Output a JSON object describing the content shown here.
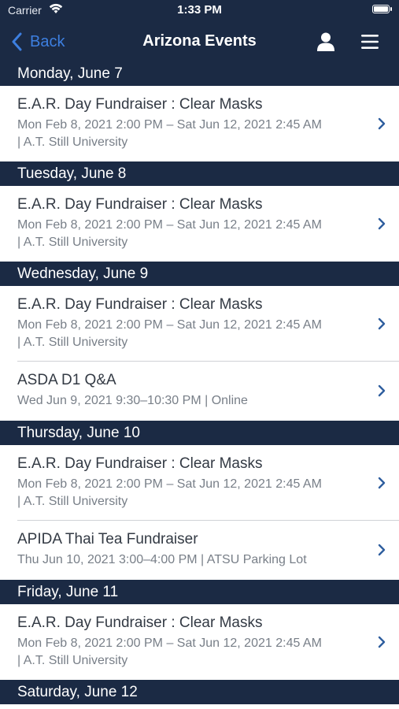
{
  "status_bar": {
    "carrier": "Carrier",
    "time": "1:33 PM"
  },
  "nav": {
    "back_label": "Back",
    "title": "Arizona Events"
  },
  "colors": {
    "header_bg": "#1b2a44",
    "accent": "#3d7fe0",
    "chevron": "#2e5e9e"
  },
  "icons": [
    "wifi-icon",
    "battery-icon",
    "back-chevron-icon",
    "user-icon",
    "menu-icon",
    "chevron-right-icon"
  ],
  "days": [
    {
      "label": "Monday, June 7",
      "events": [
        {
          "name": "E.A.R. Day Fundraiser : Clear Masks",
          "when": "Mon Feb 8, 2021 2:00 PM – Sat Jun 12, 2021 2:45 AM",
          "where": "| A.T. Still University"
        }
      ]
    },
    {
      "label": "Tuesday, June 8",
      "events": [
        {
          "name": "E.A.R. Day Fundraiser : Clear Masks",
          "when": "Mon Feb 8, 2021 2:00 PM – Sat Jun 12, 2021 2:45 AM",
          "where": "| A.T. Still University"
        }
      ]
    },
    {
      "label": "Wednesday, June 9",
      "events": [
        {
          "name": "E.A.R. Day Fundraiser : Clear Masks",
          "when": "Mon Feb 8, 2021 2:00 PM – Sat Jun 12, 2021 2:45 AM",
          "where": "| A.T. Still University"
        },
        {
          "name": "ASDA D1 Q&A",
          "when": "Wed Jun 9, 2021 9:30–10:30 PM  | Online",
          "where": ""
        }
      ]
    },
    {
      "label": "Thursday, June 10",
      "events": [
        {
          "name": "E.A.R. Day Fundraiser : Clear Masks",
          "when": "Mon Feb 8, 2021 2:00 PM – Sat Jun 12, 2021 2:45 AM",
          "where": "| A.T. Still University"
        },
        {
          "name": "APIDA Thai Tea Fundraiser",
          "when": "Thu Jun 10, 2021 3:00–4:00 PM  | ATSU Parking Lot",
          "where": ""
        }
      ]
    },
    {
      "label": "Friday, June 11",
      "events": [
        {
          "name": "E.A.R. Day Fundraiser : Clear Masks",
          "when": "Mon Feb 8, 2021 2:00 PM – Sat Jun 12, 2021 2:45 AM",
          "where": "| A.T. Still University"
        }
      ]
    },
    {
      "label": "Saturday, June 12",
      "events": []
    }
  ]
}
